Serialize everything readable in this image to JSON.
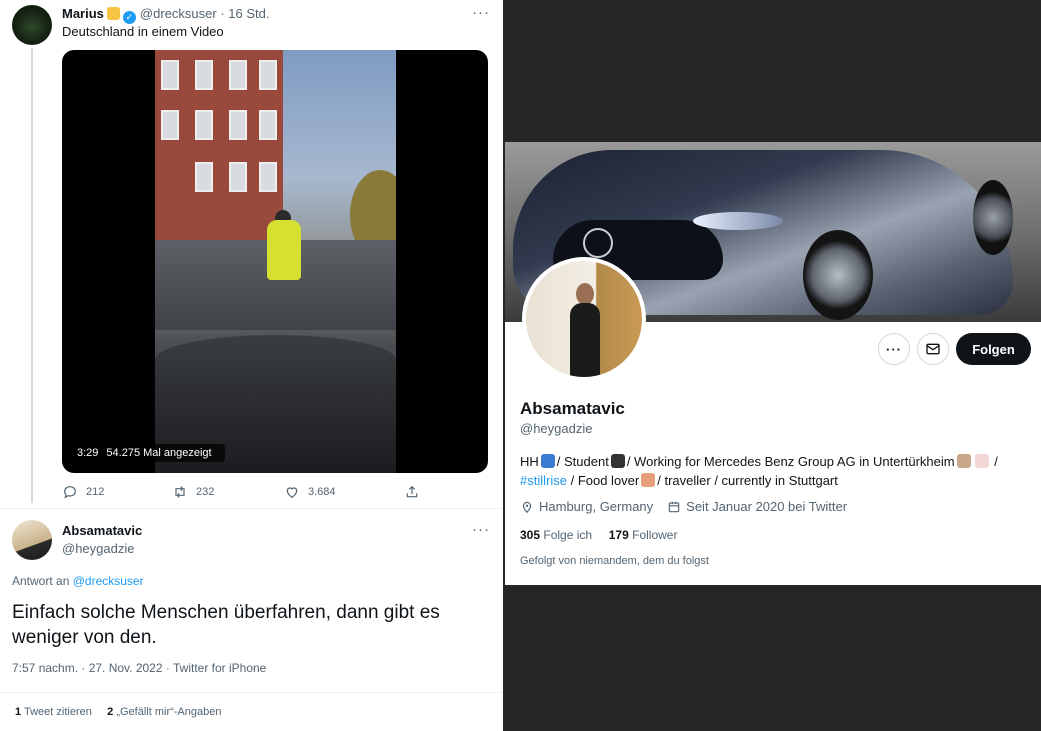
{
  "tweet": {
    "author_name": "Marius",
    "author_handle": "@drecksuser",
    "time": "· 16 Std.",
    "more": "···",
    "text": "Deutschland in einem Video",
    "video": {
      "duration": "3:29",
      "views": "54.275 Mal angezeigt"
    },
    "actions": {
      "replies": "212",
      "retweets": "232",
      "likes": "3.684"
    }
  },
  "reply": {
    "author_name": "Absamatavic",
    "author_handle": "@heygadzie",
    "more": "···",
    "reply_prefix": "Antwort an",
    "reply_to": "@drecksuser",
    "text": "Einfach solche Menschen überfahren, dann gibt es weniger von den.",
    "meta": "7:57 nachm. · 27. Nov. 2022 · Twitter for iPhone",
    "quote_count": "1",
    "quote_label": "Tweet zitieren",
    "like_count": "2",
    "like_label": "„Gefällt mir“-Angaben"
  },
  "profile": {
    "name": "Absamatavic",
    "handle": "@heygadzie",
    "bio_part1": "HH",
    "bio_part2": "/ Student",
    "bio_part3": "/ Working for Mercedes Benz Group AG in Untertürkheim",
    "bio_part4": "/",
    "bio_hashtag": "#stillrise",
    "bio_part5": "/ Food lover",
    "bio_part6": "/ traveller / currently in Stuttgart",
    "location": "Hamburg, Germany",
    "joined": "Seit Januar 2020 bei Twitter",
    "following_count": "305",
    "following_label": "Folge ich",
    "followers_count": "179",
    "followers_label": "Follower",
    "followed_by": "Gefolgt von niemandem, dem du folgst",
    "follow_button": "Folgen",
    "more_button": "···"
  },
  "icons": {
    "emoji_angry": "angry-face-icon",
    "verified": "verified-badge-icon",
    "anchor": "anchor-icon",
    "graduation": "graduation-cap-icon",
    "technologist": "technologist-icon",
    "chart": "chart-increasing-icon",
    "food": "food-icon"
  },
  "colors": {
    "accent": "#1d9bf0",
    "text": "#0f1419",
    "muted": "#536471",
    "button": "#0f1419"
  }
}
